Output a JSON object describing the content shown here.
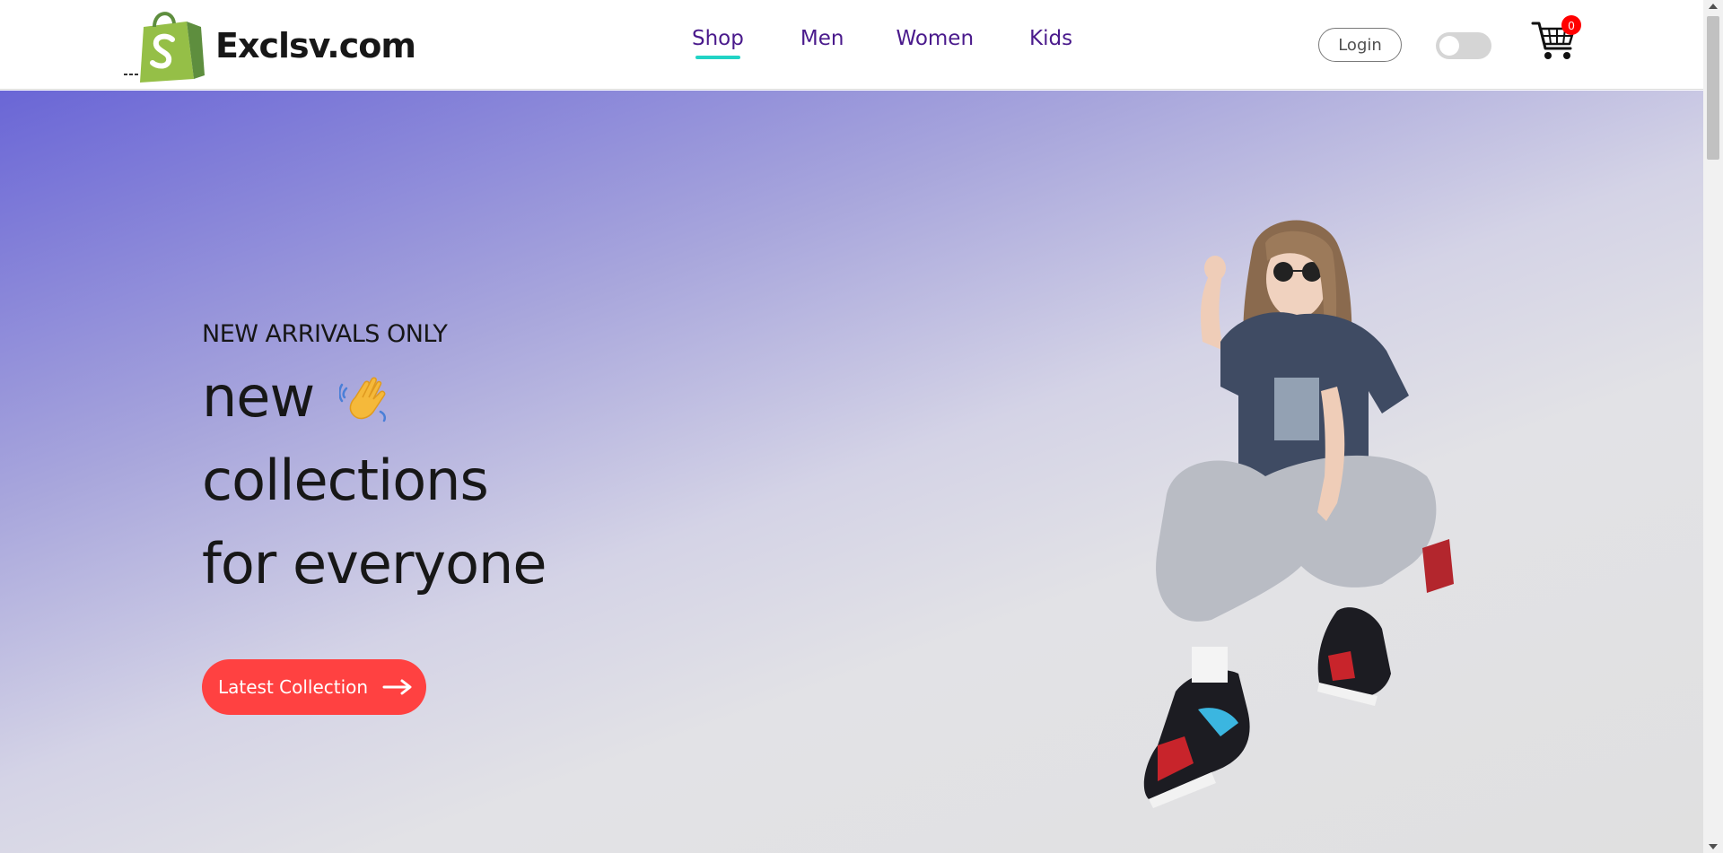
{
  "brand": {
    "name": "Exclsv.com"
  },
  "nav": {
    "items": [
      {
        "label": "Shop",
        "active": true
      },
      {
        "label": "Men",
        "active": false
      },
      {
        "label": "Women",
        "active": false
      },
      {
        "label": "Kids",
        "active": false
      }
    ],
    "active_underline_color": "#22d3c5",
    "text_color": "#4a1a8c"
  },
  "header": {
    "login_label": "Login",
    "theme_toggle_on": false,
    "cart_count": "0"
  },
  "hero": {
    "tagline": "NEW ARRIVALS ONLY",
    "line1": "new",
    "line2": "collections",
    "line3": "for everyone",
    "cta_label": "Latest Collection",
    "cta_color": "#ff4141"
  },
  "icons": [
    "shopping-bag-logo-icon",
    "waving-hand-icon",
    "cart-icon",
    "arrow-right-icon"
  ]
}
